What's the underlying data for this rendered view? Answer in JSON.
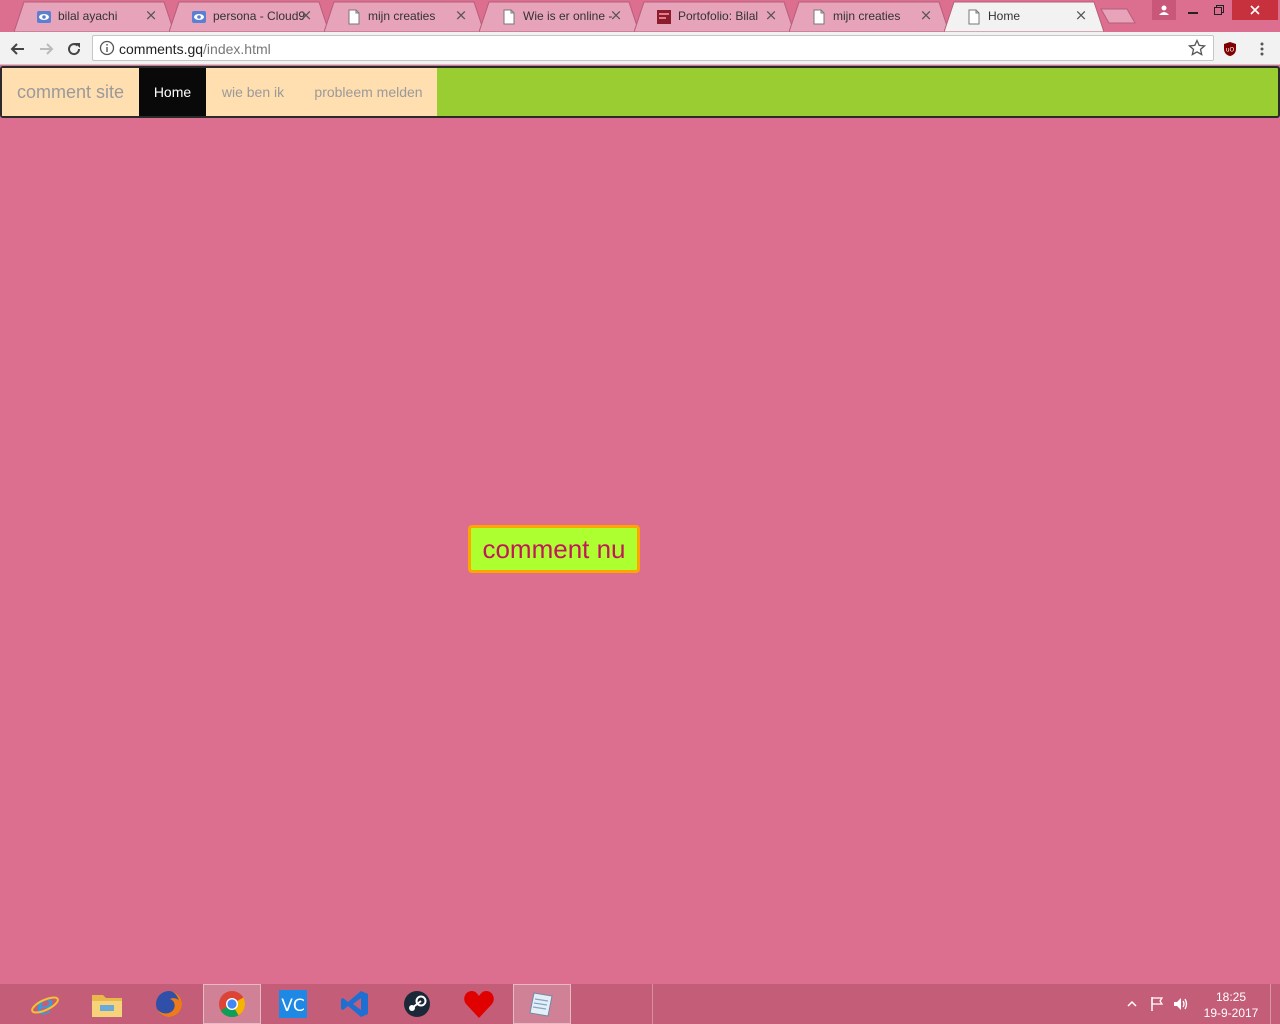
{
  "browser": {
    "tabs": [
      {
        "label": "bilal ayachi",
        "icon": "cloud9-eye-icon",
        "active": false
      },
      {
        "label": "persona - Cloud9",
        "icon": "cloud9-eye-icon",
        "active": false
      },
      {
        "label": "mijn creaties",
        "icon": "page-icon",
        "active": false
      },
      {
        "label": "Wie is er online -",
        "icon": "page-icon",
        "active": false
      },
      {
        "label": "Portofolio: Bilal",
        "icon": "portfolio-icon",
        "active": false
      },
      {
        "label": "mijn creaties",
        "icon": "page-icon",
        "active": false
      },
      {
        "label": "Home",
        "icon": "page-icon",
        "active": true
      }
    ],
    "tab_close_glyph": "×",
    "url_host": "comments.gq",
    "url_path": "/index.html"
  },
  "site": {
    "brand": "comment site",
    "nav": [
      {
        "label": "Home",
        "active": true
      },
      {
        "label": "wie ben ik",
        "active": false
      },
      {
        "label": "probleem melden",
        "active": false
      }
    ],
    "cta_label": "comment nu"
  },
  "colors": {
    "page_background": "#dc6e90",
    "navbar_background": "#9acd32",
    "nav_item_background": "#ffdeb0",
    "nav_active_background": "#090909",
    "cta_background": "#adff2f",
    "cta_border": "#ffa500",
    "cta_text": "#c2185b"
  },
  "taskbar": {
    "items": [
      "internet-explorer-icon",
      "file-explorer-icon",
      "firefox-icon",
      "chrome-icon",
      "vc-icon",
      "visual-studio-icon",
      "steam-icon",
      "heart-app-icon",
      "notepad-icon"
    ],
    "time": "18:25",
    "date": "19-9-2017"
  }
}
